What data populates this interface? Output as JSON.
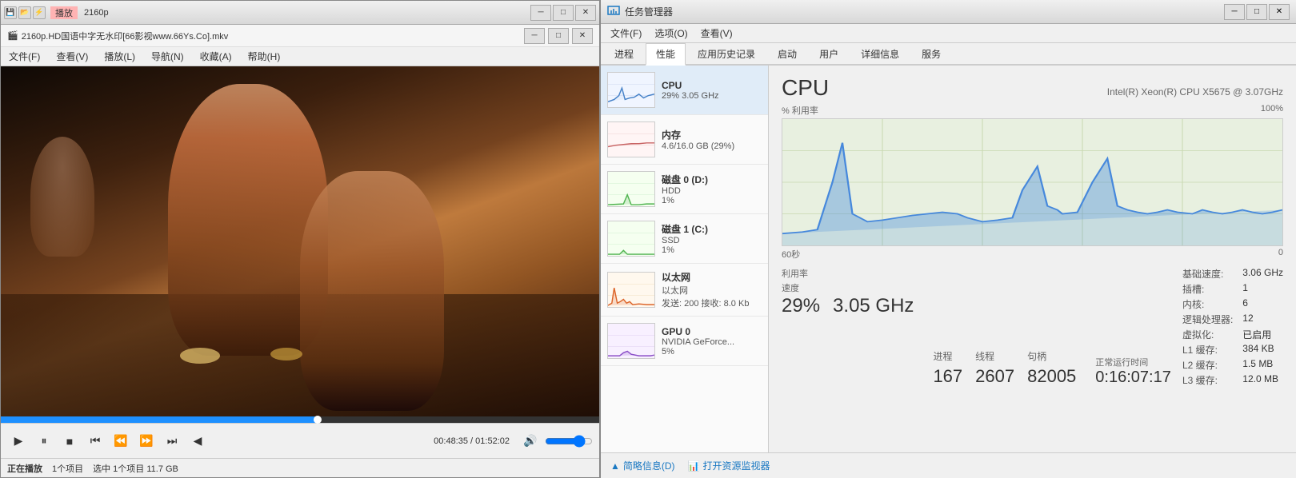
{
  "media_player": {
    "title_bar": {
      "badge": "播放",
      "resolution": "2160p",
      "minimize": "─",
      "maximize": "□",
      "close": "✕"
    },
    "file_title": "2160p.HD国语中字无水印[66影视www.66Ys.Co].mkv",
    "menus": [
      "文件(F)",
      "查看(V)",
      "播放(L)",
      "导航(N)",
      "收藏(A)",
      "帮助(H)"
    ],
    "status": "正在播放",
    "status_bar_items": [
      "1个项目",
      "选中 1个项目  11.7 GB"
    ],
    "time_current": "00:48:35",
    "time_total": "01:52:02",
    "controls": {
      "play": "▶",
      "pause": "⏸",
      "stop": "■",
      "prev": "⏮",
      "rewind": "⏪",
      "fast_forward": "⏩",
      "next": "⏭",
      "frame_back": "◀",
      "volume": "🔊"
    }
  },
  "task_manager": {
    "title": "任务管理器",
    "menus": [
      "文件(F)",
      "选项(O)",
      "查看(V)"
    ],
    "tabs": [
      "进程",
      "性能",
      "应用历史记录",
      "启动",
      "用户",
      "详细信息",
      "服务"
    ],
    "active_tab": "性能",
    "sidebar": {
      "items": [
        {
          "name": "CPU",
          "sub": "29% 3.05 GHz",
          "chart_type": "cpu",
          "active": true
        },
        {
          "name": "内存",
          "sub": "4.6/16.0 GB (29%)",
          "chart_type": "memory"
        },
        {
          "name": "磁盘 0 (D:)",
          "sub2": "HDD",
          "sub": "1%",
          "chart_type": "disk0"
        },
        {
          "name": "磁盘 1 (C:)",
          "sub2": "SSD",
          "sub": "1%",
          "chart_type": "disk1"
        },
        {
          "name": "以太网",
          "sub2": "以太网",
          "sub": "发送: 200 接收: 8.0 Kb",
          "chart_type": "ethernet"
        },
        {
          "name": "GPU 0",
          "sub2": "NVIDIA GeForce...",
          "sub": "5%",
          "chart_type": "gpu"
        }
      ]
    },
    "cpu_panel": {
      "title": "CPU",
      "model": "Intel(R) Xeon(R) CPU X5675 @ 3.07GHz",
      "graph_label_left": "% 利用率",
      "graph_label_right": "100%",
      "time_label_left": "60秒",
      "time_label_right": "0",
      "utilization_label": "利用率",
      "utilization_value": "29%",
      "speed_label": "速度",
      "speed_value": "3.05 GHz",
      "process_label": "进程",
      "process_value": "167",
      "thread_label": "线程",
      "thread_value": "2607",
      "handle_label": "句柄",
      "handle_value": "82005",
      "uptime_label": "正常运行时间",
      "uptime_value": "0:16:07:17",
      "base_speed_label": "基础速度:",
      "base_speed_value": "3.06 GHz",
      "socket_label": "插槽:",
      "socket_value": "1",
      "core_label": "内核:",
      "core_value": "6",
      "logical_label": "逻辑处理器:",
      "logical_value": "12",
      "virtualization_label": "虚拟化:",
      "virtualization_value": "已启用",
      "l1_label": "L1 缓存:",
      "l1_value": "384 KB",
      "l2_label": "L2 缓存:",
      "l2_value": "1.5 MB",
      "l3_label": "L3 缓存:",
      "l3_value": "12.0 MB"
    },
    "bottom": {
      "summary_link": "简略信息(D)",
      "monitor_link": "打开资源监视器"
    }
  }
}
